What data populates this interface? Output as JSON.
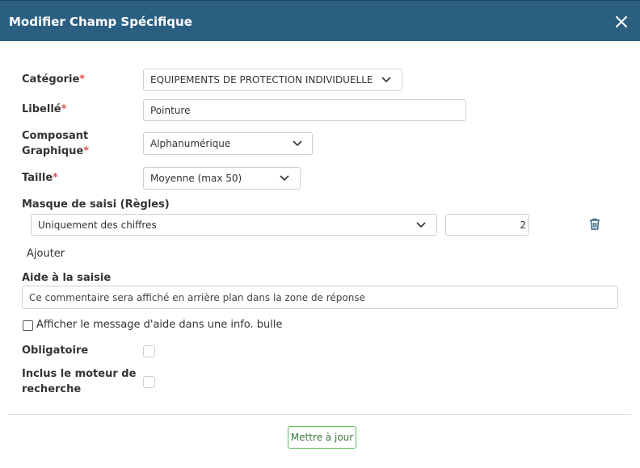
{
  "dialog": {
    "title": "Modifier Champ Spécifique",
    "close_icon": "close-icon"
  },
  "fields": {
    "categorie": {
      "label": "Catégorie",
      "required_mark": "*",
      "value": "EQUIPEMENTS DE PROTECTION INDIVIDUELLE"
    },
    "libelle": {
      "label": "Libellé",
      "required_mark": "*",
      "value": "Pointure"
    },
    "composant": {
      "label_line1": "Composant",
      "label_line2": "Graphique",
      "required_mark": "*",
      "value": "Alphanumérique"
    },
    "taille": {
      "label": "Taille",
      "required_mark": "*",
      "value": "Moyenne (max 50)"
    }
  },
  "masque": {
    "label": "Masque de saisi (Règles)",
    "rule": {
      "type_value": "Uniquement des chiffres",
      "param_value": "2"
    },
    "add_label": "Ajouter"
  },
  "aide": {
    "label": "Aide à la saisie",
    "placeholder": "Ce commentaire sera affiché en arrière plan dans la zone de réponse",
    "tooltip_checkbox_label": "Afficher le message d'aide dans une info. bulle",
    "tooltip_checked": false
  },
  "options": {
    "obligatoire": {
      "label": "Obligatoire",
      "checked": false
    },
    "moteur": {
      "label_line1": "Inclus le moteur de",
      "label_line2": "recherche",
      "checked": false
    }
  },
  "footer": {
    "update_label": "Mettre à jour"
  },
  "colors": {
    "header_bg": "#2b5f82",
    "required": "#d9534f",
    "update_border": "#5cb85c"
  }
}
